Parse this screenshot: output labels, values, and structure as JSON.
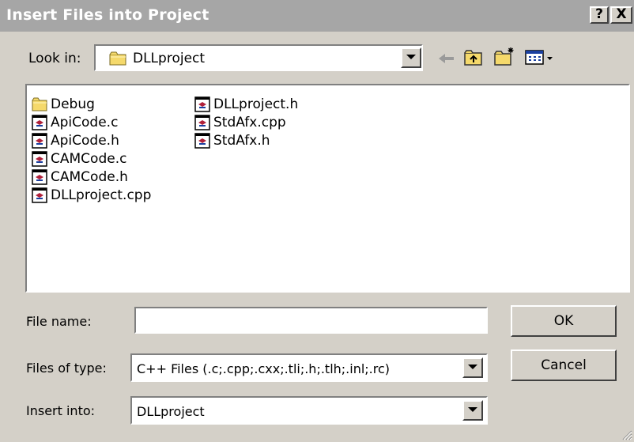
{
  "window": {
    "title": "Insert Files into Project",
    "help_label": "?",
    "close_label": "X"
  },
  "look_in": {
    "label": "Look in:",
    "value": "DLLproject"
  },
  "toolbar": {
    "icons": [
      "back-arrow-icon",
      "up-folder-icon",
      "new-folder-icon",
      "view-menu-icon"
    ]
  },
  "files": {
    "column1": [
      {
        "name": "Debug",
        "icon": "folder-icon"
      },
      {
        "name": "ApiCode.c",
        "icon": "source-file-icon"
      },
      {
        "name": "ApiCode.h",
        "icon": "source-file-icon"
      },
      {
        "name": "CAMCode.c",
        "icon": "source-file-icon"
      },
      {
        "name": "CAMCode.h",
        "icon": "source-file-icon"
      },
      {
        "name": "DLLproject.cpp",
        "icon": "source-file-icon"
      }
    ],
    "column2": [
      {
        "name": "DLLproject.h",
        "icon": "source-file-icon"
      },
      {
        "name": "StdAfx.cpp",
        "icon": "source-file-icon"
      },
      {
        "name": "StdAfx.h",
        "icon": "source-file-icon"
      }
    ]
  },
  "file_name": {
    "label": "File name:",
    "value": ""
  },
  "files_of_type": {
    "label": "Files of type:",
    "value": "C++ Files (.c;.cpp;.cxx;.tli;.h;.tlh;.inl;.rc)"
  },
  "insert_into": {
    "label": "Insert into:",
    "value": "DLLproject"
  },
  "buttons": {
    "ok": "OK",
    "cancel": "Cancel"
  },
  "colors": {
    "title_bar": "#a6a6a6",
    "face": "#d4d0c8",
    "folder": "#f5d96b"
  }
}
